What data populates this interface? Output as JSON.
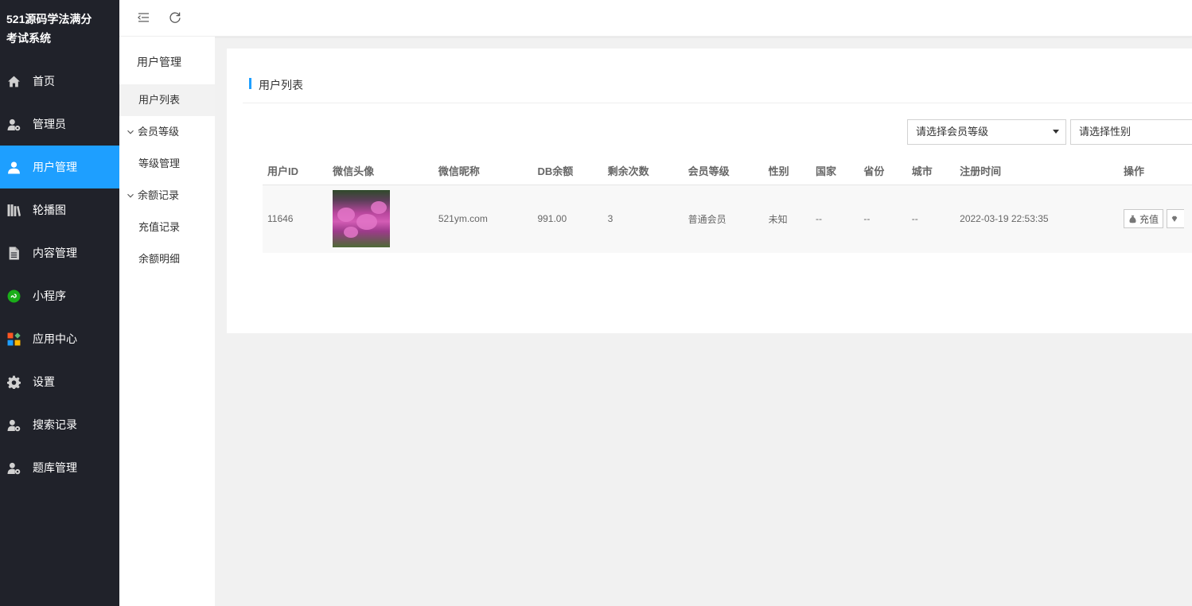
{
  "brand": {
    "line1": "521源码学法满分",
    "line2": "考试系统"
  },
  "sidebar": {
    "items": [
      {
        "label": "首页",
        "icon": "home-icon",
        "active": false
      },
      {
        "label": "管理员",
        "icon": "user-gear-icon",
        "active": false
      },
      {
        "label": "用户管理",
        "icon": "user-icon",
        "active": true
      },
      {
        "label": "轮播图",
        "icon": "library-icon",
        "active": false
      },
      {
        "label": "内容管理",
        "icon": "document-icon",
        "active": false
      },
      {
        "label": "小程序",
        "icon": "mini-program-icon",
        "active": false
      },
      {
        "label": "应用中心",
        "icon": "app-grid-icon",
        "active": false
      },
      {
        "label": "设置",
        "icon": "gear-icon",
        "active": false
      },
      {
        "label": "搜索记录",
        "icon": "user-gear-icon",
        "active": false
      },
      {
        "label": "题库管理",
        "icon": "user-gear-icon",
        "active": false
      }
    ]
  },
  "submenu": {
    "title": "用户管理",
    "user_list": "用户列表",
    "member_group": "会员等级",
    "level_manage": "等级管理",
    "balance_group": "余额记录",
    "recharge_record": "充值记录",
    "balance_detail": "余额明细"
  },
  "card": {
    "title": "用户列表",
    "level_select": "请选择会员等级",
    "gender_select": "请选择性别"
  },
  "table": {
    "headers": [
      "用户ID",
      "微信头像",
      "微信昵称",
      "DB余额",
      "剩余次数",
      "会员等级",
      "性别",
      "国家",
      "省份",
      "城市",
      "注册时间",
      "操作"
    ],
    "rows": [
      {
        "id": "11646",
        "nickname": "521ym.com",
        "balance": "991.00",
        "remaining": "3",
        "level": "普通会员",
        "gender": "未知",
        "country": "--",
        "province": "--",
        "city": "--",
        "registered": "2022-03-19 22:53:35",
        "recharge_label": "充值"
      }
    ]
  },
  "colors": {
    "sidebar_bg": "#20222a",
    "accent": "#1e9fff"
  }
}
